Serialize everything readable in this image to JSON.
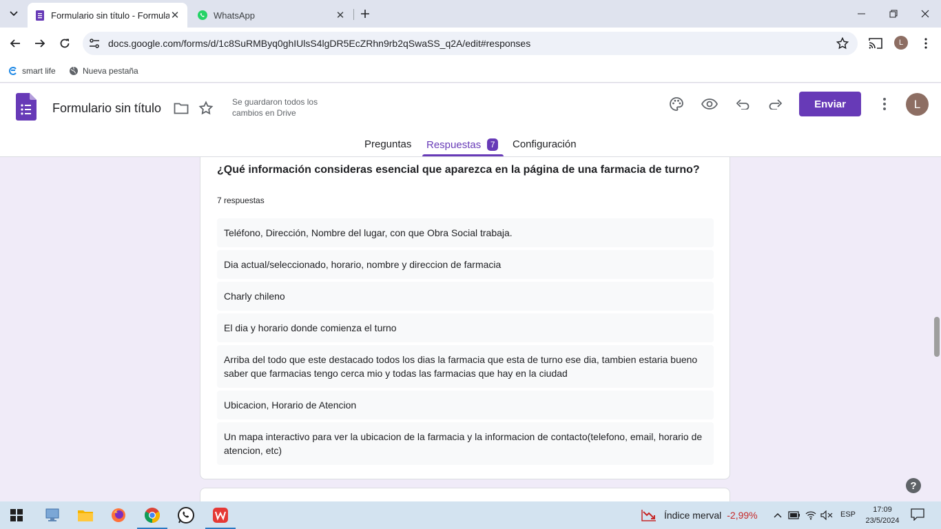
{
  "browser": {
    "tabs": [
      {
        "title": "Formulario sin título - Formular",
        "active": true,
        "icon": "google-forms-icon"
      },
      {
        "title": "WhatsApp",
        "active": false,
        "icon": "whatsapp-icon"
      }
    ],
    "url": "docs.google.com/forms/d/1c8SuRMByq0ghIUlsS4lgDR5EcZRhn9rb2qSwaSS_q2A/edit#responses",
    "profile_initial": "L",
    "bookmarks": [
      {
        "label": "smart life",
        "icon": "smart-life-icon"
      },
      {
        "label": "Nueva pestaña",
        "icon": "globe-icon"
      }
    ]
  },
  "form": {
    "title": "Formulario sin título",
    "save_status": "Se guardaron todos los cambios en Drive",
    "send_label": "Enviar",
    "avatar_initial": "L",
    "tabs": {
      "questions": "Preguntas",
      "responses": "Respuestas",
      "responses_count": "7",
      "settings": "Configuración"
    },
    "accent": "#673ab7"
  },
  "question": {
    "title": "¿Qué información consideras esencial que aparezca en la página de una farmacia de turno?",
    "count": "7 respuestas",
    "responses": [
      "Teléfono, Dirección, Nombre del lugar, con que Obra Social trabaja.",
      "Dia actual/seleccionado, horario, nombre y direccion de farmacia",
      "Charly chileno",
      "El dia y horario donde comienza el turno",
      "Arriba del todo que este destacado todos los dias la farmacia que esta de turno ese dia, tambien estaria bueno saber que farmacias tengo cerca mio y todas las farmacias que hay en la ciudad",
      "Ubicacion, Horario de Atencion",
      "Un mapa interactivo para ver la ubicacion de la farmacia y la informacion de contacto(telefono, email, horario de atencion, etc)"
    ]
  },
  "taskbar": {
    "news_label": "Índice merval",
    "news_value": "-2,99%",
    "lang": "ESP",
    "time": "17:09",
    "date": "23/5/2024"
  }
}
